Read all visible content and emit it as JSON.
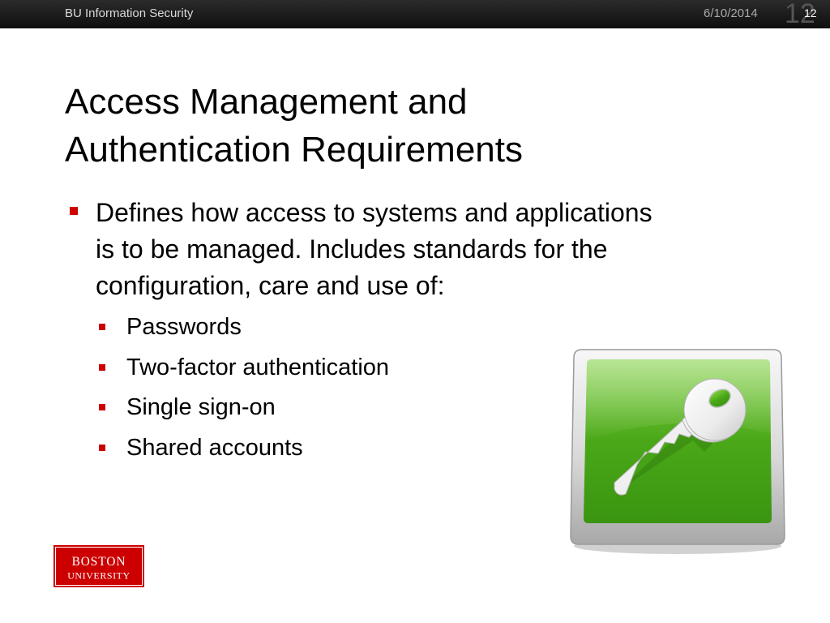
{
  "header": {
    "org": "BU Information Security",
    "date": "6/10/2014",
    "slide_number_large": "12",
    "slide_number_small": "12"
  },
  "slide": {
    "title_lines": [
      "Access Management and",
      "Authentication Requirements"
    ],
    "main_bullet_lines": [
      "Defines how access to systems and applications",
      "is to be managed. Includes standards for the",
      "configuration, care and use of:"
    ],
    "sub_bullets": [
      "Passwords",
      "Two-factor authentication",
      "Single sign-on",
      "Shared accounts"
    ]
  },
  "logo": {
    "line1": "BOSTON",
    "line2": "UNIVERSITY"
  },
  "icons": {
    "picture": "key-icon",
    "bullet": "square-bullet-icon"
  },
  "colors": {
    "accent_red": "#cc0000",
    "header_bar": "#1a1a1a",
    "icon_green": "#55b21c"
  }
}
